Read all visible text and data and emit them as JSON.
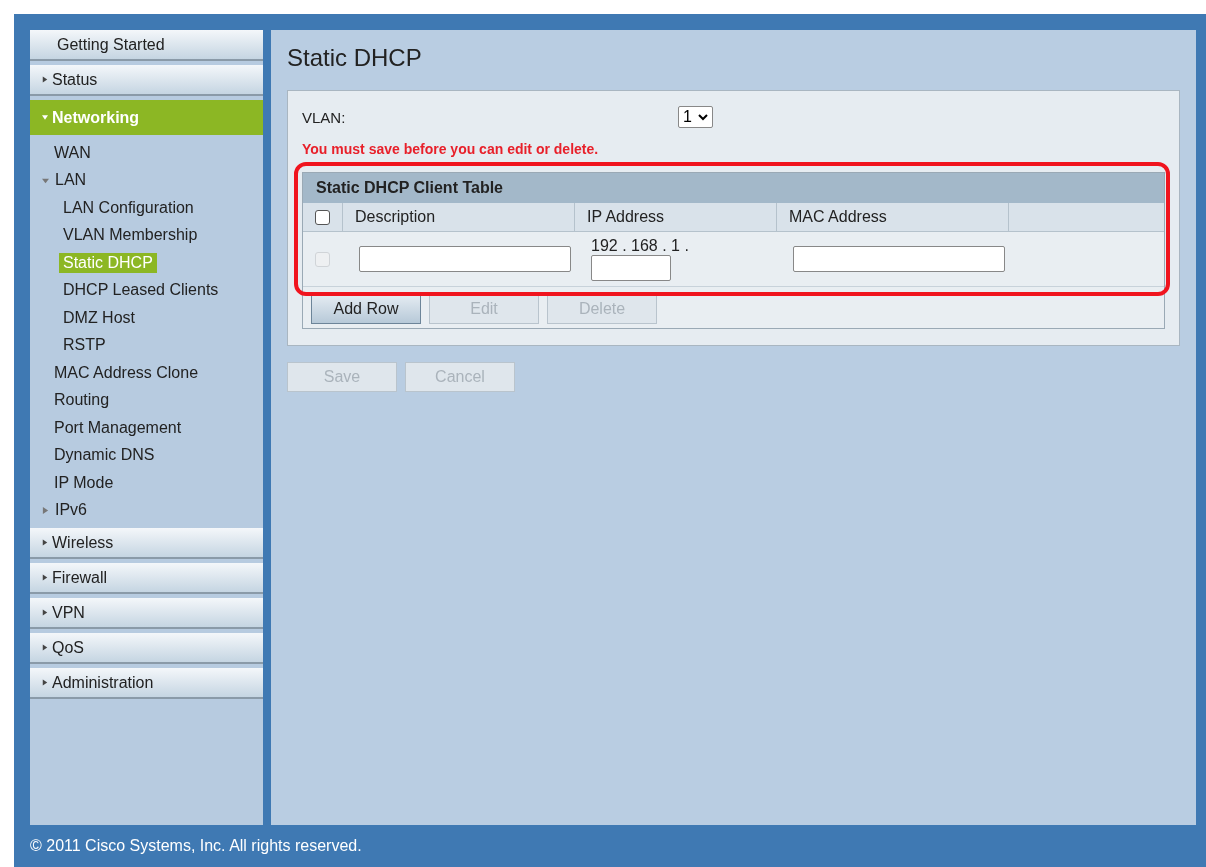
{
  "sidebar": {
    "sections": [
      {
        "label": "Getting Started",
        "kind": "link",
        "selected": false
      },
      {
        "label": "Status",
        "kind": "group",
        "expanded": false,
        "selected": false
      },
      {
        "label": "Networking",
        "kind": "group",
        "expanded": true,
        "selected": true,
        "children": [
          {
            "label": "WAN",
            "kind": "leaf",
            "selected": false
          },
          {
            "label": "LAN",
            "kind": "group",
            "expanded": true,
            "children": [
              {
                "label": "LAN Configuration",
                "selected": false
              },
              {
                "label": "VLAN Membership",
                "selected": false
              },
              {
                "label": "Static DHCP",
                "selected": true
              },
              {
                "label": "DHCP Leased Clients",
                "selected": false
              },
              {
                "label": "DMZ Host",
                "selected": false
              },
              {
                "label": "RSTP",
                "selected": false
              }
            ]
          },
          {
            "label": "MAC Address Clone",
            "kind": "leaf",
            "selected": false
          },
          {
            "label": "Routing",
            "kind": "leaf",
            "selected": false
          },
          {
            "label": "Port Management",
            "kind": "leaf",
            "selected": false
          },
          {
            "label": "Dynamic DNS",
            "kind": "leaf",
            "selected": false
          },
          {
            "label": "IP Mode",
            "kind": "leaf",
            "selected": false
          },
          {
            "label": "IPv6",
            "kind": "group",
            "expanded": false
          }
        ]
      },
      {
        "label": "Wireless",
        "kind": "group",
        "expanded": false,
        "selected": false
      },
      {
        "label": "Firewall",
        "kind": "group",
        "expanded": false,
        "selected": false
      },
      {
        "label": "VPN",
        "kind": "group",
        "expanded": false,
        "selected": false
      },
      {
        "label": "QoS",
        "kind": "group",
        "expanded": false,
        "selected": false
      },
      {
        "label": "Administration",
        "kind": "group",
        "expanded": false,
        "selected": false
      }
    ]
  },
  "page": {
    "title": "Static DHCP",
    "vlan": {
      "label": "VLAN:",
      "value": "1"
    },
    "warning": "You must save before you can edit or delete.",
    "table": {
      "title": "Static DHCP Client Table",
      "highlighted": true,
      "header_checked": false,
      "columns": [
        "Description",
        "IP Address",
        "MAC Address"
      ],
      "rows": [
        {
          "checked": false,
          "disabled": true,
          "ip_prefix": "192 . 168 . 1 ."
        }
      ]
    },
    "table_buttons": [
      {
        "label": "Add Row",
        "disabled": false
      },
      {
        "label": "Edit",
        "disabled": true
      },
      {
        "label": "Delete",
        "disabled": true
      }
    ],
    "buttons": [
      {
        "label": "Save",
        "disabled": true
      },
      {
        "label": "Cancel",
        "disabled": true
      }
    ]
  },
  "footer": "© 2011 Cisco Systems, Inc. All rights reserved."
}
